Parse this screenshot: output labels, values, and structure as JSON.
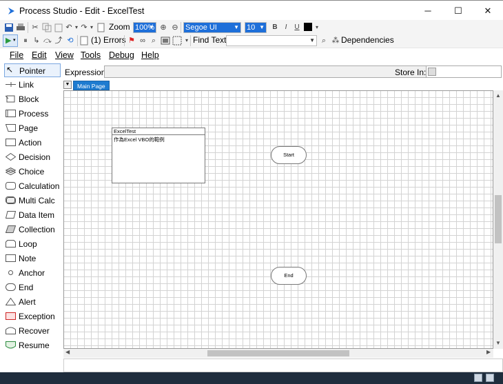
{
  "window": {
    "title": "Process Studio  - Edit - ExcelTest",
    "minimize_glyph": "─",
    "maximize_glyph": "☐",
    "close_glyph": "✕"
  },
  "toolbar1": {
    "zoom_label": "Zoom",
    "zoom_value": "100%",
    "font_name": "Segoe UI",
    "font_size": "10",
    "bold": "B",
    "italic": "I",
    "underline": "U"
  },
  "toolbar2": {
    "errors_label": "(1) Errors",
    "find_text_label": "Find Text",
    "find_text_value": "",
    "dependencies_label": "Dependencies"
  },
  "menu": [
    {
      "label": "File"
    },
    {
      "label": "Edit"
    },
    {
      "label": "View"
    },
    {
      "label": "Tools"
    },
    {
      "label": "Debug"
    },
    {
      "label": "Help"
    }
  ],
  "palette": [
    {
      "label": "Pointer",
      "icon": "pointer-icon"
    },
    {
      "label": "Link",
      "icon": "link-icon"
    },
    {
      "label": "Block",
      "icon": "block-icon"
    },
    {
      "label": "Process",
      "icon": "process-icon"
    },
    {
      "label": "Page",
      "icon": "page-icon"
    },
    {
      "label": "Action",
      "icon": "action-icon"
    },
    {
      "label": "Decision",
      "icon": "decision-icon"
    },
    {
      "label": "Choice",
      "icon": "choice-icon"
    },
    {
      "label": "Calculation",
      "icon": "calculation-icon"
    },
    {
      "label": "Multi Calc",
      "icon": "multi-calc-icon"
    },
    {
      "label": "Data Item",
      "icon": "data-item-icon"
    },
    {
      "label": "Collection",
      "icon": "collection-icon"
    },
    {
      "label": "Loop",
      "icon": "loop-icon"
    },
    {
      "label": "Note",
      "icon": "note-icon"
    },
    {
      "label": "Anchor",
      "icon": "anchor-icon"
    },
    {
      "label": "End",
      "icon": "end-icon"
    },
    {
      "label": "Alert",
      "icon": "alert-icon"
    },
    {
      "label": "Exception",
      "icon": "exception-icon"
    },
    {
      "label": "Recover",
      "icon": "recover-icon"
    },
    {
      "label": "Resume",
      "icon": "resume-icon"
    }
  ],
  "expression": {
    "label": "Expression:",
    "value": "",
    "store_in_label": "Store In:",
    "store_in_value": ""
  },
  "page_tabs": [
    {
      "label": "Main Page"
    }
  ],
  "diagram": {
    "info_box_title": "ExcelTest",
    "info_box_body": "作為Excel VBO的範例",
    "start_label": "Start",
    "end_label": "End"
  },
  "colors": {
    "accent": "#1e7bd0",
    "taskbar": "#1f2d3d"
  }
}
